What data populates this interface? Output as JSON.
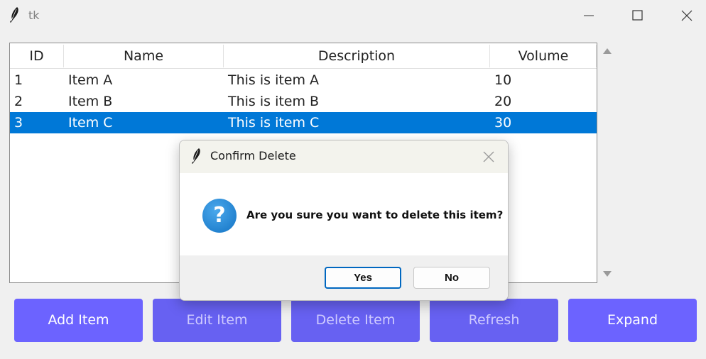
{
  "window": {
    "title": "tk"
  },
  "tree": {
    "columns": [
      "ID",
      "Name",
      "Description",
      "Volume"
    ],
    "rows": [
      {
        "id": "1",
        "name": "Item A",
        "description": "This is item A",
        "volume": "10"
      },
      {
        "id": "2",
        "name": "Item B",
        "description": "This is item B",
        "volume": "20"
      },
      {
        "id": "3",
        "name": "Item C",
        "description": "This is item C",
        "volume": "30"
      }
    ],
    "selected_row": 2
  },
  "buttons": {
    "add": "Add Item",
    "edit": "Edit Item",
    "delete": "Delete Item",
    "refresh": "Refresh",
    "expand": "Expand"
  },
  "dialog": {
    "title": "Confirm Delete",
    "message": "Are you sure you want to delete this item?",
    "icon": "question-icon",
    "yes": "Yes",
    "no": "No"
  },
  "colors": {
    "button_bg": "#6c63ff",
    "selection": "#0078d7",
    "dialog_default_border": "#0067c0"
  }
}
